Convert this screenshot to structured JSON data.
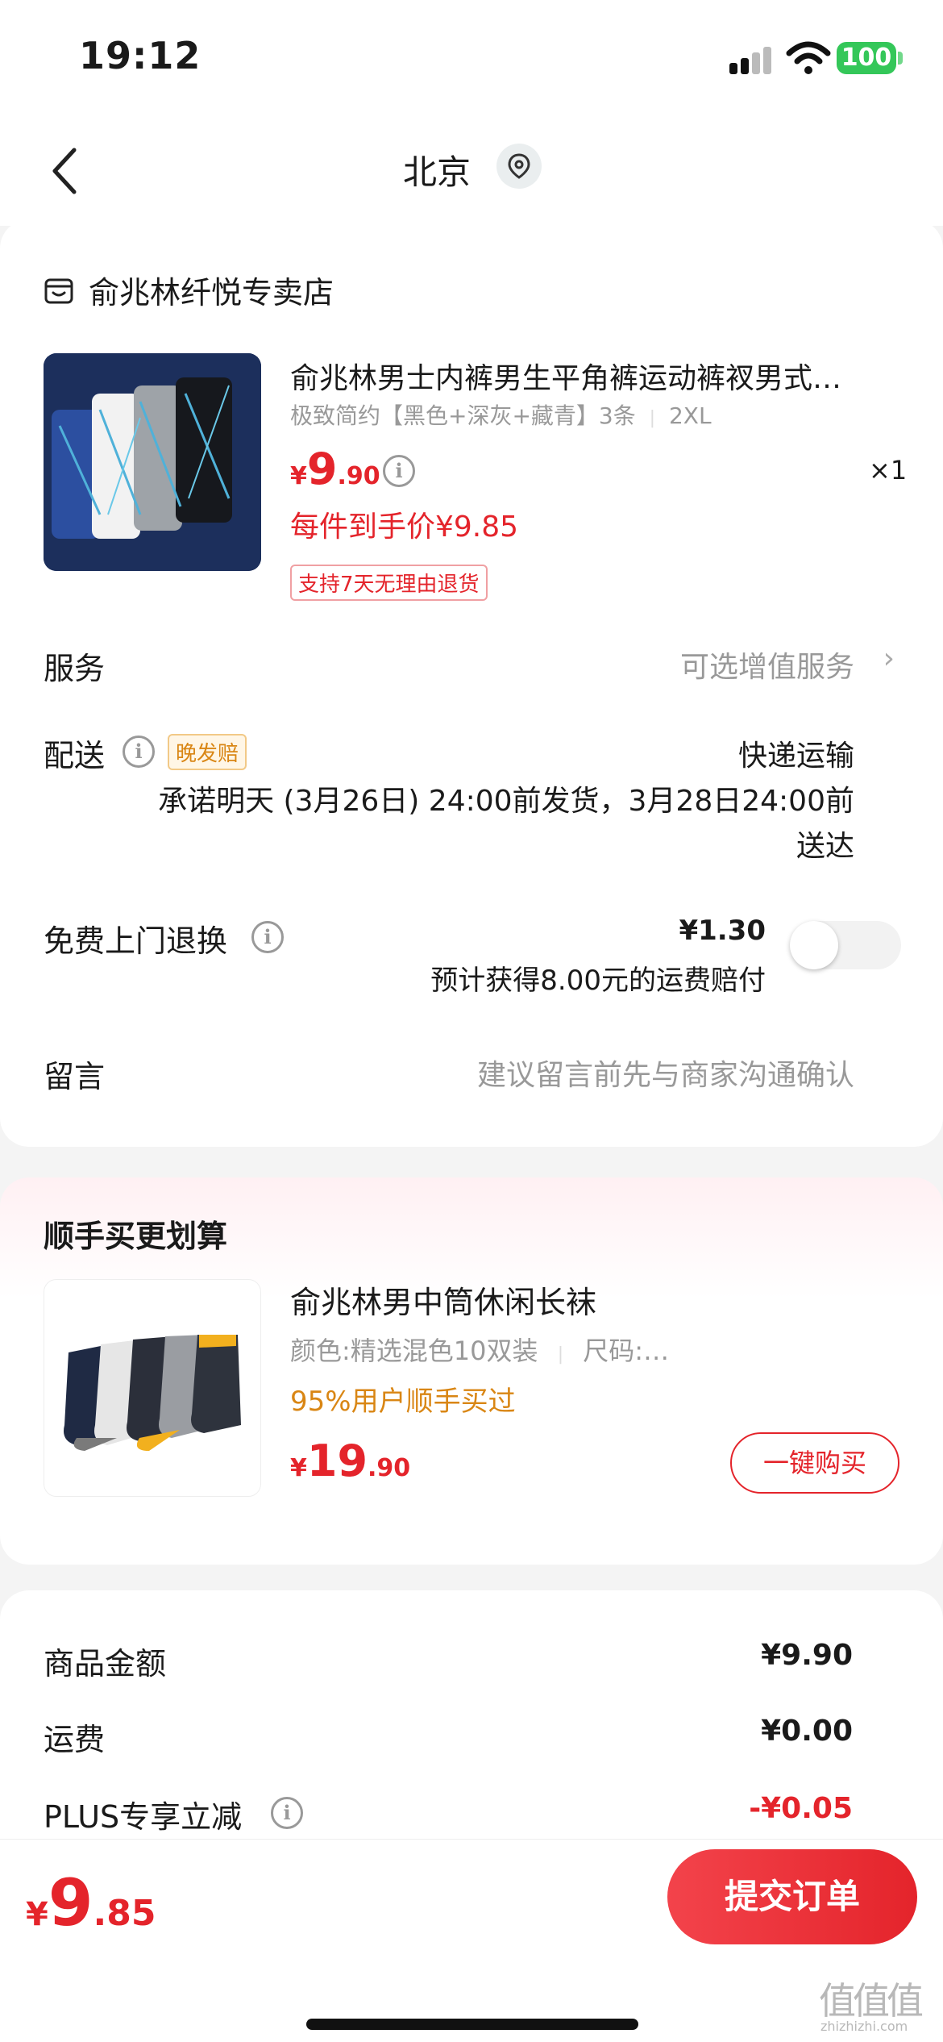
{
  "status": {
    "time": "19:12",
    "battery": "100"
  },
  "nav": {
    "title": "北京"
  },
  "order": {
    "store": "俞兆林纤悦专卖店",
    "product": {
      "title": "俞兆林男士内裤男生平角裤运动裤衩男式…",
      "spec": "极致简约【黑色+深灰+藏青】3条",
      "size": "2XL",
      "price_symbol": "¥",
      "price_int": "9",
      "price_dec": ".90",
      "qty": "×1",
      "unit_price": "每件到手价¥9.85",
      "return_tag": "支持7天无理由退货"
    },
    "service": {
      "label": "服务",
      "value": "可选增值服务"
    },
    "delivery": {
      "label": "配送",
      "tag": "晚发赔",
      "method": "快递运输",
      "line1": "承诺明天 (3月26日) 24:00前发货，3月28日24:00前",
      "line2": "送达"
    },
    "free_return": {
      "label": "免费上门退换",
      "price": "¥1.30",
      "note": "预计获得8.00元的运费赔付",
      "enabled": false
    },
    "message": {
      "label": "留言",
      "placeholder": "建议留言前先与商家沟通确认"
    }
  },
  "upsell": {
    "title": "顺手买更划算",
    "product": {
      "title": "俞兆林男中筒休闲长袜",
      "spec_color": "颜色:精选混色10双装",
      "spec_size": "尺码:…",
      "social": "95%用户顺手买过",
      "price_symbol": "¥",
      "price_int": "19",
      "price_dec": ".90",
      "buy_label": "一键购买"
    }
  },
  "summary": {
    "goods_label": "商品金额",
    "goods_value": "¥9.90",
    "shipping_label": "运费",
    "shipping_value": "¥0.00",
    "plus_label": "PLUS专享立减",
    "plus_value": "-¥0.05"
  },
  "footer": {
    "total_symbol": "¥",
    "total_int": "9",
    "total_dec": ".85",
    "submit_label": "提交订单"
  },
  "watermark": {
    "main": "值值值",
    "sub": "zhizhizhi.com"
  },
  "colors": {
    "accent": "#e4242b",
    "orange": "#d98614",
    "toggle_on": "#34c759"
  }
}
